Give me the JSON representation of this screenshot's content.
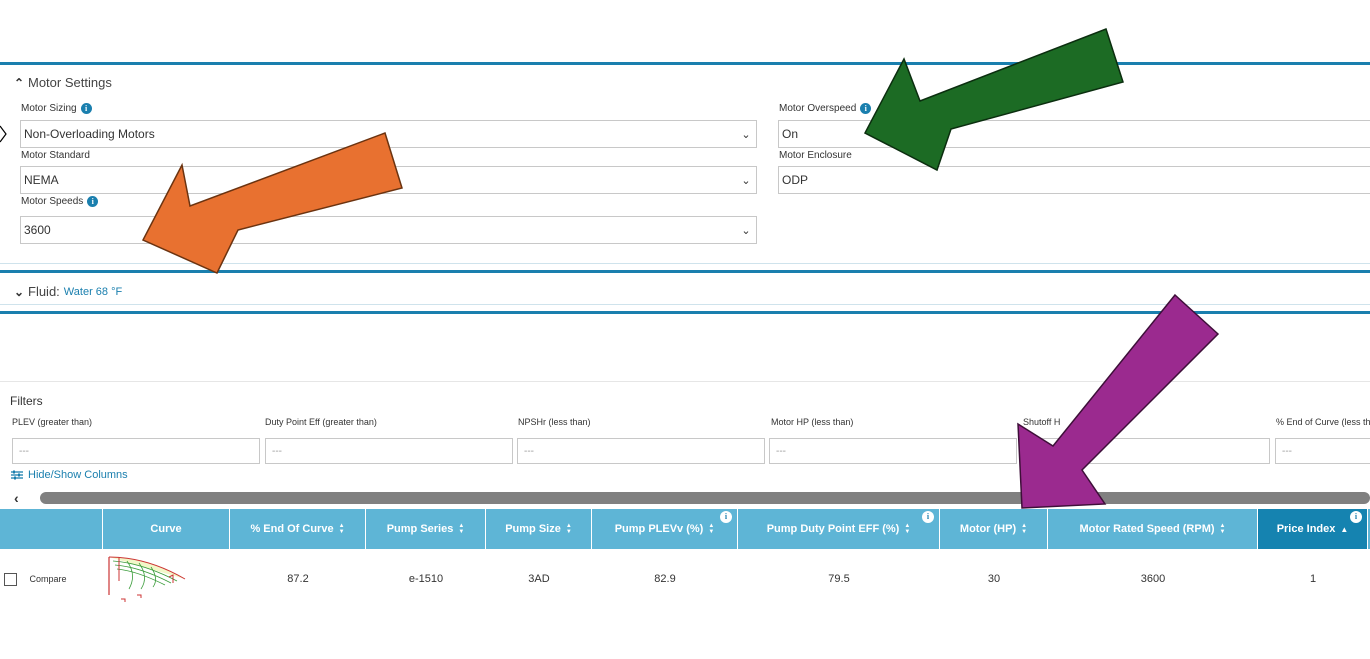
{
  "motor_settings": {
    "title": "Motor Settings",
    "motor_sizing": {
      "label": "Motor Sizing",
      "value": "Non-Overloading Motors"
    },
    "motor_overspeed": {
      "label": "Motor Overspeed",
      "value": "On"
    },
    "motor_standard": {
      "label": "Motor Standard",
      "value": "NEMA"
    },
    "motor_enclosure": {
      "label": "Motor Enclosure",
      "value": "ODP"
    },
    "motor_speeds": {
      "label": "Motor Speeds",
      "value": "3600"
    }
  },
  "fluid": {
    "label": "Fluid:",
    "value": "Water 68 °F"
  },
  "filters": {
    "title": "Filters",
    "items": [
      {
        "label": "PLEV (greater than)",
        "placeholder": "---"
      },
      {
        "label": "Duty Point Eff (greater than)",
        "placeholder": "---"
      },
      {
        "label": "NPSHr (less than)",
        "placeholder": "---"
      },
      {
        "label": "Motor HP (less than)",
        "placeholder": "---"
      },
      {
        "label": "Shutoff H",
        "placeholder": "---"
      },
      {
        "label": "% End of Curve (less tha",
        "placeholder": "---"
      }
    ],
    "hide_show": "Hide/Show Columns"
  },
  "table": {
    "headers": [
      "",
      "Curve",
      "% End Of Curve",
      "Pump Series",
      "Pump Size",
      "Pump PLEVv (%)",
      "Pump Duty Point EFF (%)",
      "Motor (HP)",
      "Motor Rated Speed (RPM)",
      "Price Index"
    ],
    "row": {
      "compare": "Compare",
      "end_of_curve": "87.2",
      "series": "e-1510",
      "size": "3AD",
      "plev": "82.9",
      "duty_eff": "79.5",
      "motor_hp": "30",
      "rated_speed": "3600",
      "price_index": "1"
    }
  },
  "icons": {
    "info": "info-icon",
    "collapse": "chevron-double-up-icon",
    "expand": "chevron-double-down-icon",
    "caret": "chevron-down-icon",
    "columns": "sliders-icon",
    "sort": "sort-icon"
  },
  "colors": {
    "accent": "#1a7fae",
    "header_bg": "#5eb5d6",
    "header_active": "#1583b0",
    "arrow_orange": "#e87130",
    "arrow_green": "#1c6b24",
    "arrow_purple": "#9b2a8f"
  }
}
